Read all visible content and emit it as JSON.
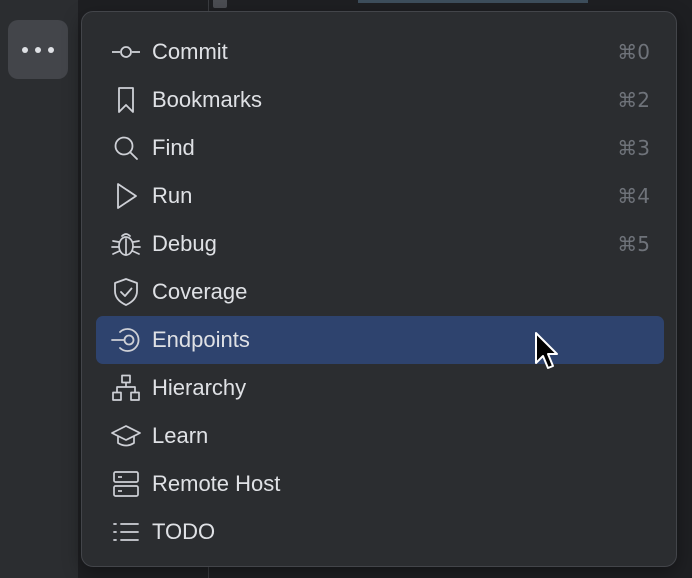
{
  "toolbar": {
    "more_icon": "more-horizontal-icon"
  },
  "menu": {
    "selected_index": 6,
    "items": [
      {
        "label": "Commit",
        "icon": "commit-icon",
        "shortcut": "⌘0"
      },
      {
        "label": "Bookmarks",
        "icon": "bookmark-icon",
        "shortcut": "⌘2"
      },
      {
        "label": "Find",
        "icon": "search-icon",
        "shortcut": "⌘3"
      },
      {
        "label": "Run",
        "icon": "play-icon",
        "shortcut": "⌘4"
      },
      {
        "label": "Debug",
        "icon": "bug-icon",
        "shortcut": "⌘5"
      },
      {
        "label": "Coverage",
        "icon": "shield-check-icon",
        "shortcut": ""
      },
      {
        "label": "Endpoints",
        "icon": "endpoints-icon",
        "shortcut": ""
      },
      {
        "label": "Hierarchy",
        "icon": "hierarchy-icon",
        "shortcut": ""
      },
      {
        "label": "Learn",
        "icon": "graduation-cap-icon",
        "shortcut": ""
      },
      {
        "label": "Remote Host",
        "icon": "server-icon",
        "shortcut": ""
      },
      {
        "label": "TODO",
        "icon": "list-icon",
        "shortcut": ""
      }
    ]
  },
  "colors": {
    "popup_background": "#2b2d30",
    "selection": "#2e436e",
    "text": "#dfe1e5",
    "shortcut_text": "#6f737a",
    "icon_stroke": "#ced0d6"
  }
}
